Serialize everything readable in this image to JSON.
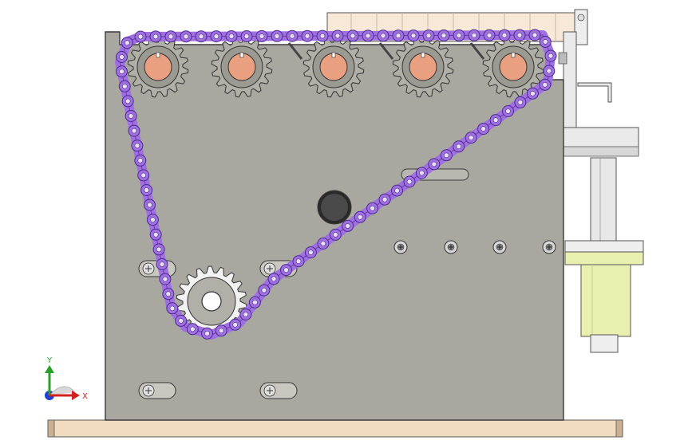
{
  "triad": {
    "y_label": "Y",
    "x_label": "X"
  },
  "colors": {
    "background": "#ffffff",
    "plate": "#a8a8a0",
    "plate_edge": "#3a3a3a",
    "chain_link": "#a070e0",
    "chain_pin": "#e8e0f8",
    "sprocket_hub": "#e8a080",
    "base": "#f2dcc0",
    "cylinder_green": "#e8f0b0",
    "top_rail": "#f8e8d8",
    "bracket": "#e8e8e8",
    "axis_y": "#2aa02a",
    "axis_x": "#d02020",
    "axis_z": "#2040d0"
  },
  "components": {
    "sprocket_count": 5,
    "idler_sprocket_count": 1,
    "screw_count": 4,
    "slot_count": 4
  }
}
